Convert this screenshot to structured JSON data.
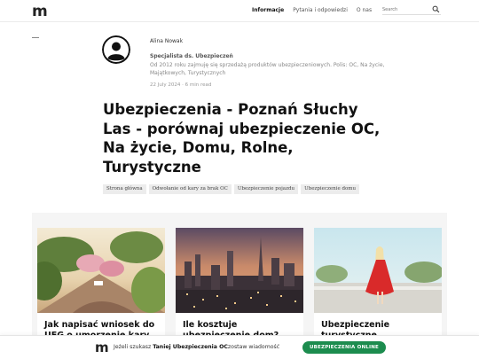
{
  "header": {
    "logo": "m",
    "nav": [
      "Informacje",
      "Pytania i odpowiedzi",
      "O nas"
    ],
    "search_placeholder": "Search"
  },
  "author": {
    "name": "Alina Nowak",
    "role": "Specjalista ds. Ubezpieczeń",
    "bio": "Od 2012 roku zajmuję się sprzedażą produktów ubezpieczeniowych. Polis: OC, Na życie, Majątkowych, Turystycznych",
    "meta": "22 July 2024 · 6 min read"
  },
  "article": {
    "title": "Ubezpieczenia - Poznań Słuchy Las - porównaj ubezpieczenie OC, Na życie, Domu, Rolne, Turystyczne"
  },
  "tags": [
    "Strona główna",
    "Odwołanie od kary za brak OC",
    "Ubezpieczenie pojazdu",
    "Ubezpieczenie domu"
  ],
  "cards": [
    {
      "title": "Jak napisać wniosek do UFG o umorzenie kary za brak OC"
    },
    {
      "title": "Ile kosztuje ubezpieczenie dom?"
    },
    {
      "title": "Ubezpieczenie turystyczne"
    }
  ],
  "banner": {
    "logo": "m",
    "text_prefix": "Jeżeli szukasz ",
    "text_bold": "Taniej Ubezpieczenia OC",
    "text_suffix": "zostaw wiadomość",
    "cta": "UBEZPIECZENIA ONLINE"
  },
  "colors": {
    "accent": "#1c8c4e",
    "text": "#111111",
    "muted": "#888888",
    "tag_bg": "#ececec"
  }
}
